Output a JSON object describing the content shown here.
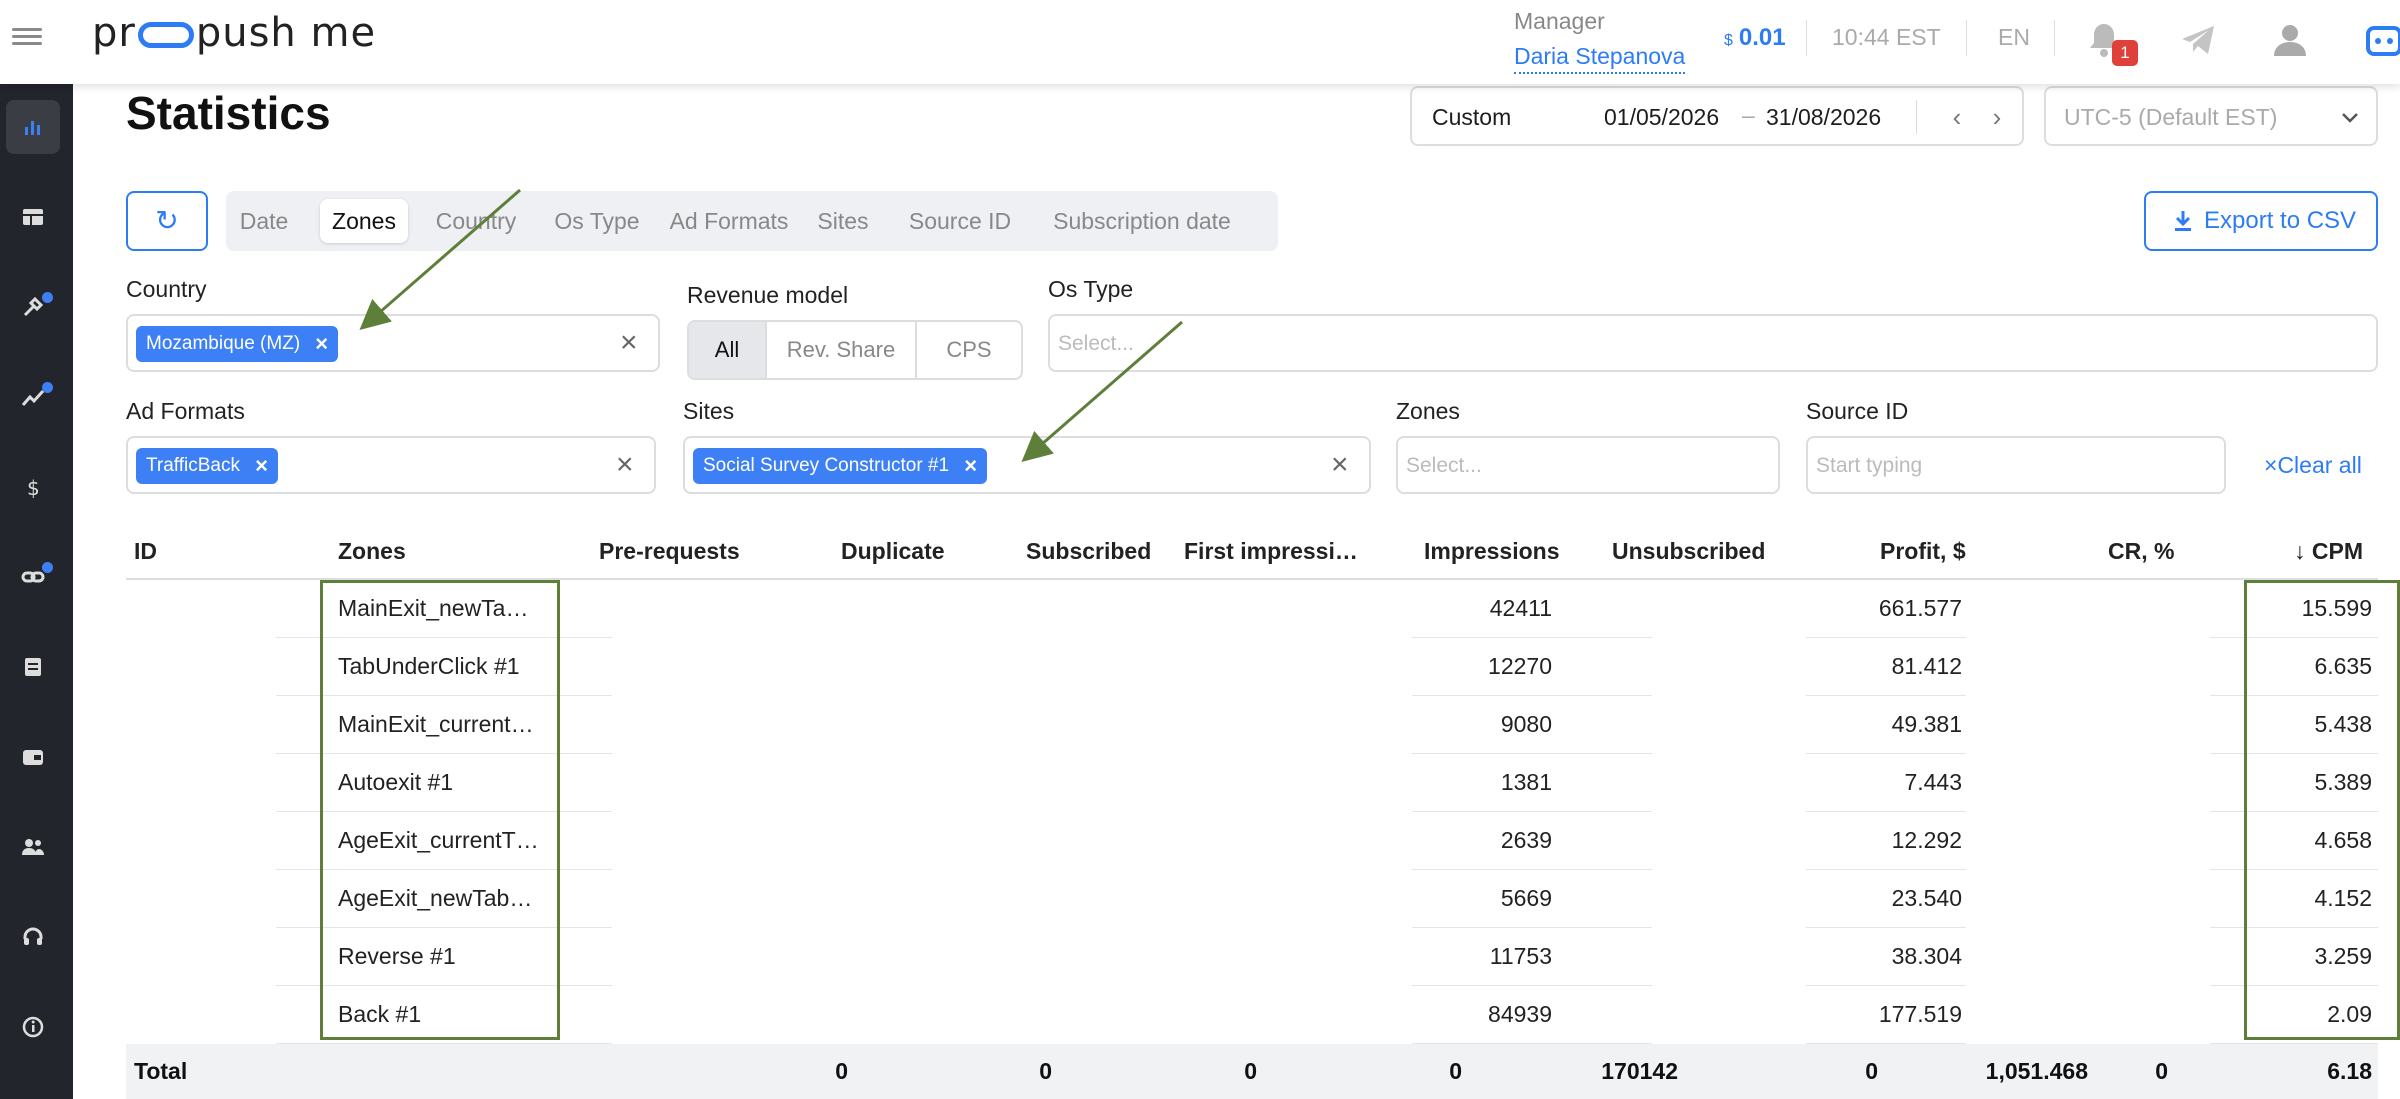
{
  "header": {
    "logo_pre": "pr",
    "logo_post": "push me",
    "manager_role": "Manager",
    "manager_name": "Daria Stepanova",
    "balance_currency": "$",
    "balance": "0.01",
    "time": "10:44 EST",
    "language": "EN",
    "notifications_count": "1"
  },
  "page": {
    "title": "Statistics",
    "date_mode": "Custom",
    "date_from": "01/05/2026",
    "date_dash": "–",
    "date_to": "31/08/2026",
    "timezone": "UTC-5 (Default EST)",
    "refresh_icon": "↻",
    "export_label": "Export to CSV"
  },
  "tabs": [
    {
      "label": "Date"
    },
    {
      "label": "Zones",
      "active": true
    },
    {
      "label": "Country"
    },
    {
      "label": "Os Type"
    },
    {
      "label": "Ad Formats"
    },
    {
      "label": "Sites"
    },
    {
      "label": "Source ID"
    },
    {
      "label": "Subscription date"
    }
  ],
  "filters": {
    "country_label": "Country",
    "country_chip": "Mozambique (MZ)",
    "revenue_label": "Revenue model",
    "revenue_options": [
      "All",
      "Rev. Share",
      "CPS"
    ],
    "revenue_selected": "All",
    "ostype_label": "Os Type",
    "ostype_placeholder": "Select...",
    "adformats_label": "Ad Formats",
    "adformats_chip": "TrafficBack",
    "sites_label": "Sites",
    "sites_chip": "Social Survey Constructor #1",
    "zones_label": "Zones",
    "zones_placeholder": "Select...",
    "sourceid_label": "Source ID",
    "sourceid_placeholder": "Start typing",
    "clear_all": "Clear all",
    "chip_remove": "×",
    "clear_x": "×"
  },
  "table": {
    "columns": [
      "ID",
      "Zones",
      "Pre-requests",
      "Duplicate",
      "Subscribed",
      "First impressi…",
      "Impressions",
      "Unsubscribed",
      "Profit, $",
      "CR, %",
      "CPM"
    ],
    "sort_indicator": "↓",
    "rows": [
      {
        "zone": "MainExit_newTa…",
        "impressions": "42411",
        "profit": "661.577",
        "cpm": "15.599"
      },
      {
        "zone": "TabUnderClick #1",
        "impressions": "12270",
        "profit": "81.412",
        "cpm": "6.635"
      },
      {
        "zone": "MainExit_current…",
        "impressions": "9080",
        "profit": "49.381",
        "cpm": "5.438"
      },
      {
        "zone": "Autoexit #1",
        "impressions": "1381",
        "profit": "7.443",
        "cpm": "5.389"
      },
      {
        "zone": "AgeExit_currentT…",
        "impressions": "2639",
        "profit": "12.292",
        "cpm": "4.658"
      },
      {
        "zone": "AgeExit_newTab…",
        "impressions": "5669",
        "profit": "23.540",
        "cpm": "4.152"
      },
      {
        "zone": "Reverse #1",
        "impressions": "11753",
        "profit": "38.304",
        "cpm": "3.259"
      },
      {
        "zone": "Back #1",
        "impressions": "84939",
        "profit": "177.519",
        "cpm": "2.09"
      }
    ],
    "total": {
      "label": "Total",
      "pre_requests": "0",
      "duplicate": "0",
      "subscribed": "0",
      "first_impressions": "0",
      "impressions": "170142",
      "unsubscribed": "0",
      "profit": "1,051.468",
      "cr": "0",
      "cpm": "6.18"
    }
  },
  "colors": {
    "accent": "#2d7cf6",
    "chip": "#3d7ff5",
    "sidebar": "#22252b",
    "annotation": "#5e7f3a",
    "badge": "#e0403a"
  }
}
